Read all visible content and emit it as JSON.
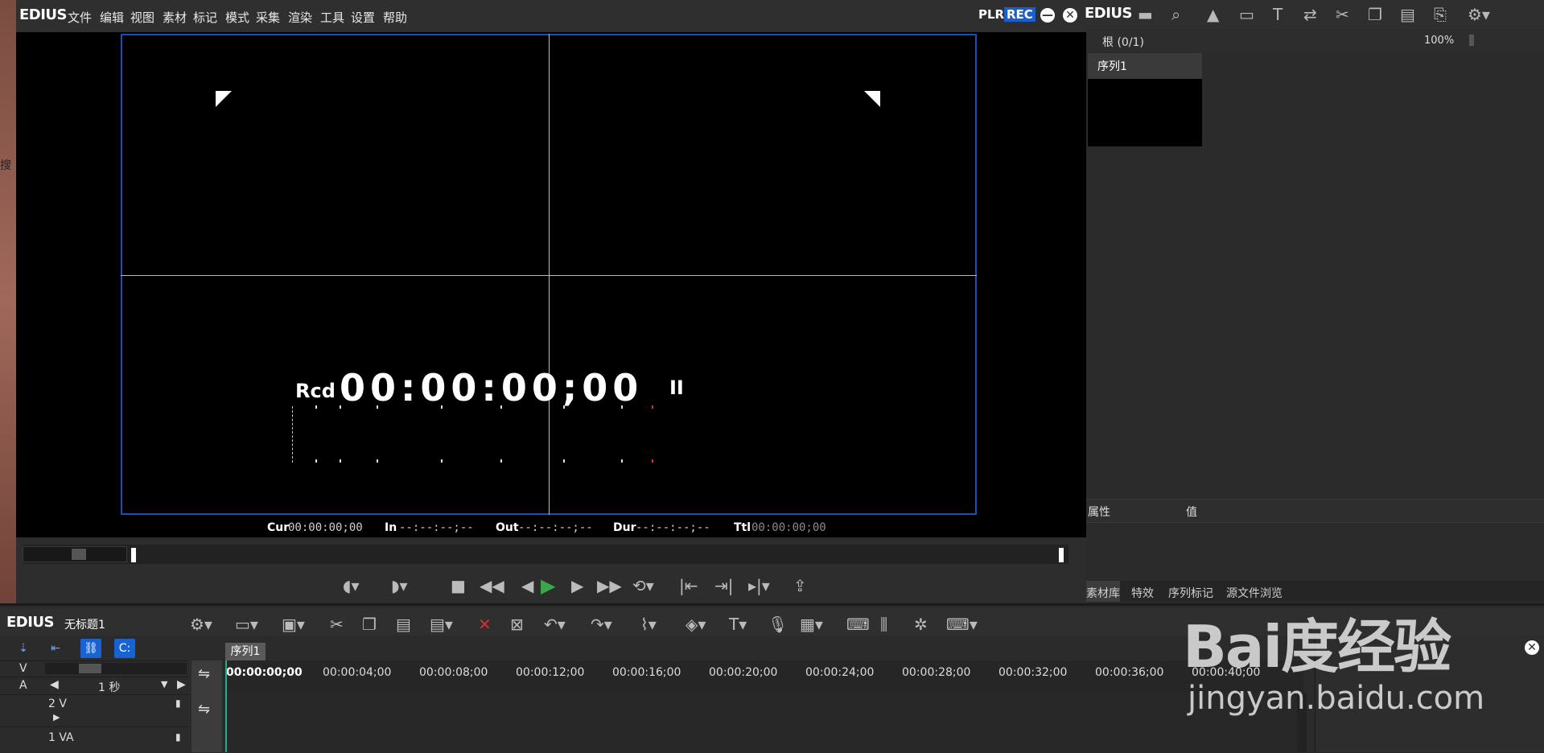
{
  "edge_text": "搜",
  "player": {
    "logo": "EDIUS",
    "menu": [
      "文件",
      "编辑",
      "视图",
      "素材",
      "标记",
      "模式",
      "采集",
      "渲染",
      "工具",
      "设置",
      "帮助"
    ],
    "plr_label": "PLR",
    "rec_label": "REC",
    "minimize_icon": "—",
    "close_icon": "✕",
    "overlay": {
      "rcd_label": "Rcd",
      "timecode": "00:00:00;00",
      "pause_icon": "II"
    },
    "status": {
      "cur_label": "Cur",
      "cur_value": "00:00:00;00",
      "in_label": "In",
      "in_value": "--:--:--;--",
      "out_label": "Out",
      "out_value": "--:--:--;--",
      "dur_label": "Dur",
      "dur_value": "--:--:--;--",
      "ttl_label": "Ttl",
      "ttl_value": "00:00:00;00"
    }
  },
  "bin": {
    "logo": "EDIUS",
    "root_label": "根 (0/1)",
    "zoom": "100%",
    "clip_name": "序列1",
    "prop_attr": "属性",
    "prop_value": "值",
    "tabs": [
      "素材库",
      "特效",
      "序列标记",
      "源文件浏览"
    ]
  },
  "timeline": {
    "logo": "EDIUS",
    "project_title": "无标题1",
    "sequence_tab": "序列1",
    "scale": "1 秒",
    "v_label": "V",
    "a_label": "A",
    "track_2v": "2 V",
    "track_1va": "1 VA",
    "ruler": [
      "00:00:00;00",
      "00:00:04;00",
      "00:00:08;00",
      "00:00:12;00",
      "00:00:16;00",
      "00:00:20;00",
      "00:00:24;00",
      "00:00:28;00",
      "00:00:32;00",
      "00:00:36;00",
      "00:00:40;00"
    ]
  },
  "watermark": {
    "brand": "Bai度经验",
    "url": "jingyan.baidu.com"
  },
  "colors": {
    "accent": "#1763d4",
    "frame_border": "#1b4fb8",
    "playhead": "#1fb08a"
  }
}
